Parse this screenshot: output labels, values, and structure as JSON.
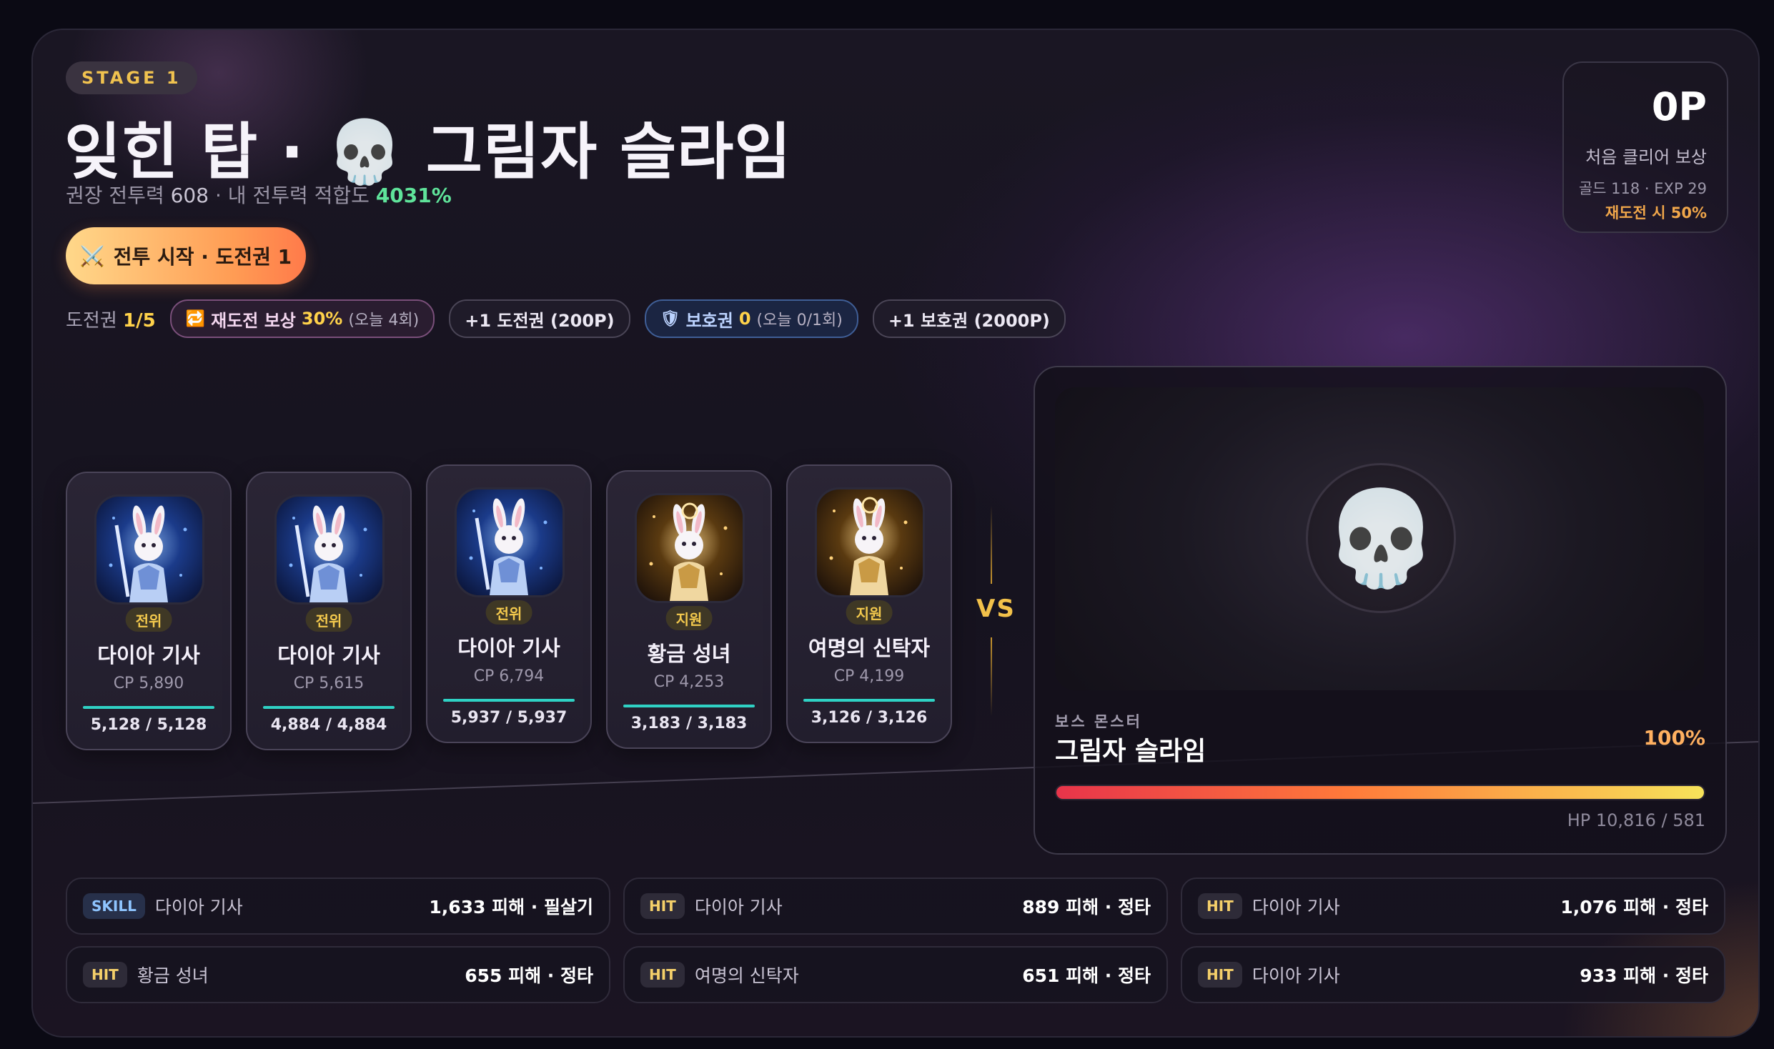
{
  "stage": {
    "badge": "STAGE 1"
  },
  "title": "잊힌 탑 · 💀 그림자 슬라임",
  "subline": {
    "recommend_label": "권장 전투력",
    "recommend_value": "608",
    "sep": "·",
    "fit_label": "내 전투력 적합도",
    "fit_value": "4031%"
  },
  "start_button": {
    "icon": "⚔️",
    "label": "전투 시작 · 도전권 1"
  },
  "tickets": {
    "label": "도전권",
    "value": "1/5",
    "retry": {
      "icon": "🔁",
      "label": "재도전 보상",
      "pct": "30%",
      "sub": "(오늘 4회)"
    },
    "buy_ticket": "+1 도전권 (200P)",
    "guard": {
      "icon": "🛡",
      "label": "보호권",
      "count": "0",
      "sub": "(오늘 0/1회)"
    },
    "buy_guard": "+1 보호권 (2000P)"
  },
  "reward": {
    "points": "0P",
    "label": "처음 클리어 보상",
    "detail": "골드 118 · EXP 29",
    "retry_note": "재도전 시 50%"
  },
  "heroes": [
    {
      "role": "전위",
      "name": "다이아 기사",
      "cp": "CP 5,890",
      "hp": "5,128 / 5,128",
      "theme": "blue",
      "hp_ratio": 1
    },
    {
      "role": "전위",
      "name": "다이아 기사",
      "cp": "CP 5,615",
      "hp": "4,884 / 4,884",
      "theme": "blue",
      "hp_ratio": 1
    },
    {
      "role": "전위",
      "name": "다이아 기사",
      "cp": "CP 6,794",
      "hp": "5,937 / 5,937",
      "theme": "blue",
      "hp_ratio": 1
    },
    {
      "role": "지원",
      "name": "황금 성녀",
      "cp": "CP 4,253",
      "hp": "3,183 / 3,183",
      "theme": "gold",
      "hp_ratio": 1
    },
    {
      "role": "지원",
      "name": "여명의 신탁자",
      "cp": "CP 4,199",
      "hp": "3,126 / 3,126",
      "theme": "gold",
      "hp_ratio": 1
    }
  ],
  "vs": "VS",
  "boss": {
    "icon": "💀",
    "tag": "보스 몬스터",
    "name": "그림자 슬라임",
    "pct": "100%",
    "hp_ratio": 1,
    "hp_text": "HP 10,816 / 581"
  },
  "logs": [
    {
      "tag": "SKILL",
      "who": "다이아 기사",
      "dmg": "1,633 피해 · 필살기"
    },
    {
      "tag": "HIT",
      "who": "다이아 기사",
      "dmg": "889 피해 · 정타"
    },
    {
      "tag": "HIT",
      "who": "다이아 기사",
      "dmg": "1,076 피해 · 정타"
    },
    {
      "tag": "HIT",
      "who": "황금 성녀",
      "dmg": "655 피해 · 정타"
    },
    {
      "tag": "HIT",
      "who": "여명의 신탁자",
      "dmg": "651 피해 · 정타"
    },
    {
      "tag": "HIT",
      "who": "다이아 기사",
      "dmg": "933 피해 · 정타"
    }
  ],
  "colors": {
    "accent_gold": "#f2c14a",
    "fit_green": "#5fe39a",
    "hp_teal": "#2fd1c4",
    "boss_red": "#e8344a"
  }
}
